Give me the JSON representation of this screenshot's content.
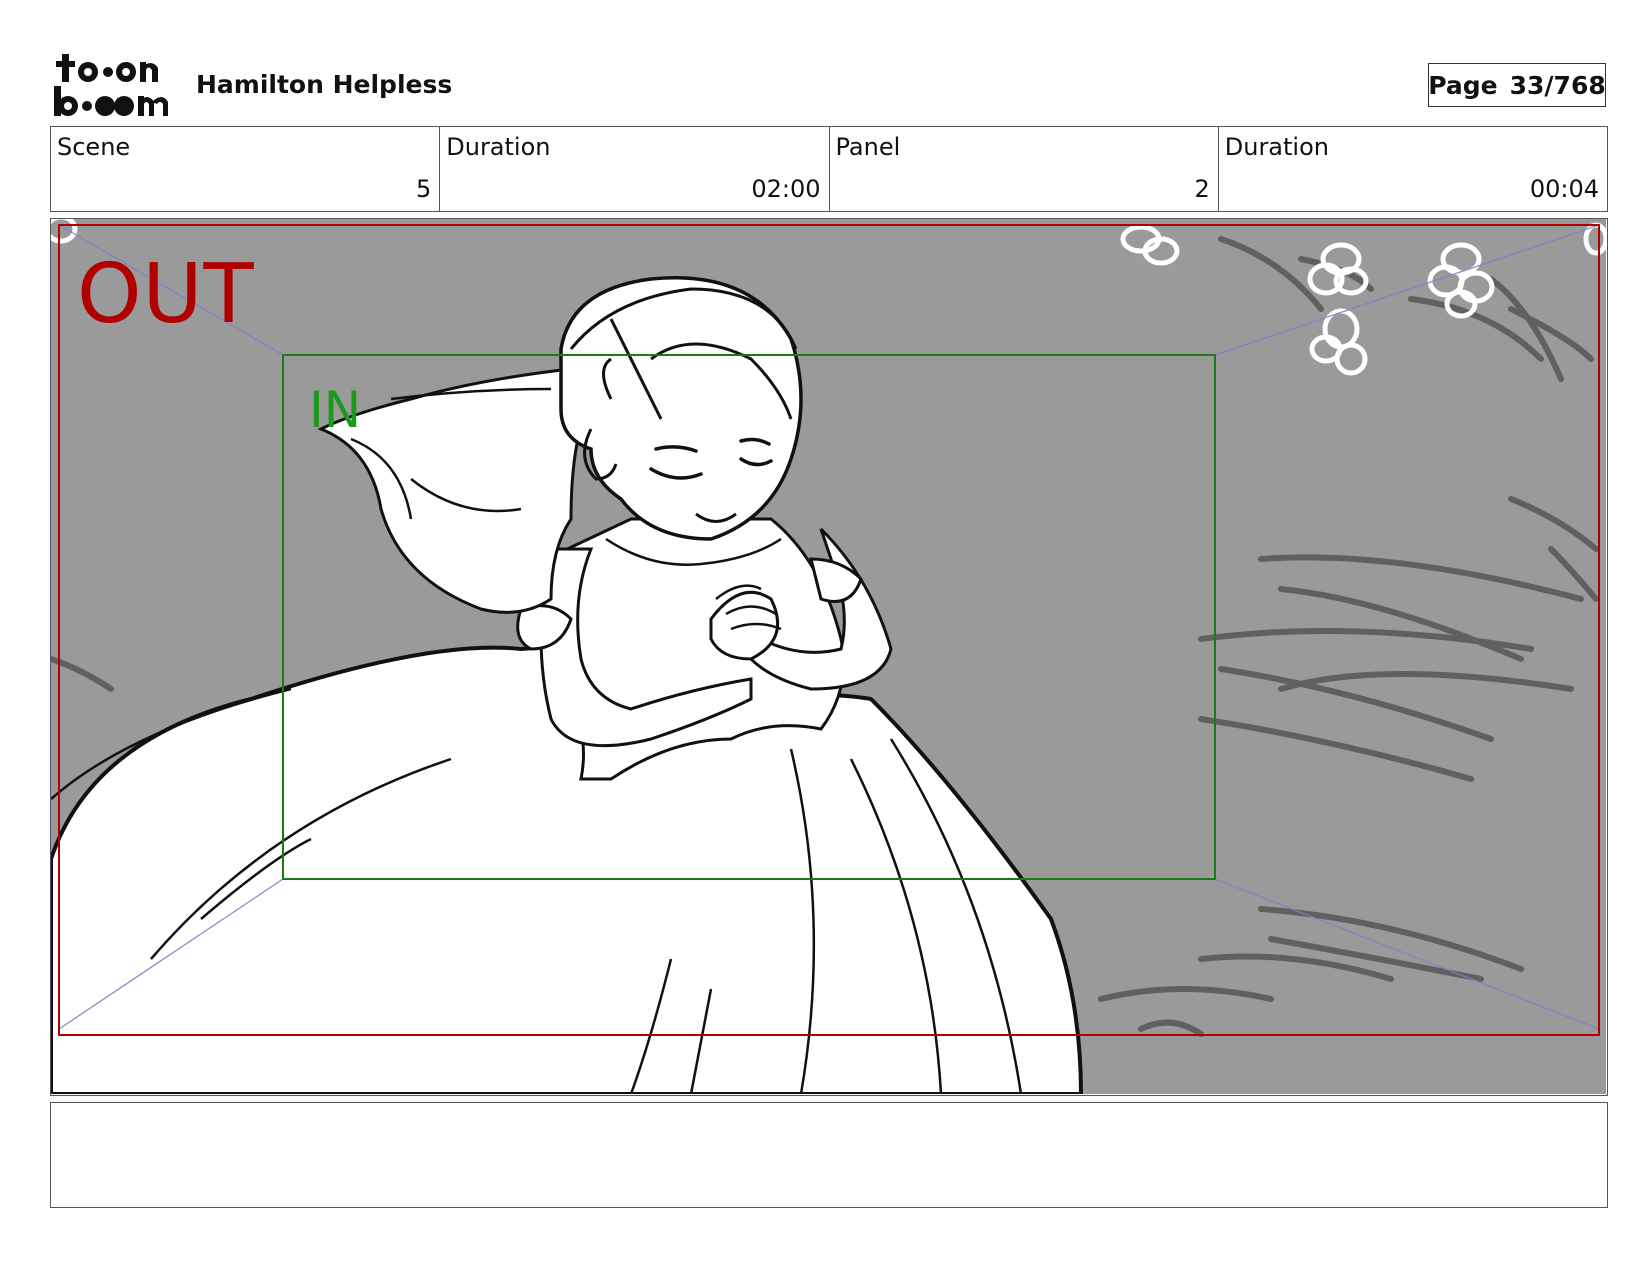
{
  "header": {
    "logo_text": "toon boom",
    "project_title": "Hamilton Helpless",
    "page_label": "Page",
    "page_value": "33/768"
  },
  "info": {
    "scene_label": "Scene",
    "scene_value": "5",
    "scene_duration_label": "Duration",
    "scene_duration_value": "02:00",
    "panel_label": "Panel",
    "panel_value": "2",
    "panel_duration_label": "Duration",
    "panel_duration_value": "00:04"
  },
  "panel": {
    "out_label": "OUT",
    "in_label": "IN",
    "colors": {
      "out_frame": "#b00000",
      "in_frame": "#1a7a1a",
      "background": "#9a9a9a",
      "guide_lines": "#8080cc"
    }
  },
  "notes": {
    "text": ""
  }
}
